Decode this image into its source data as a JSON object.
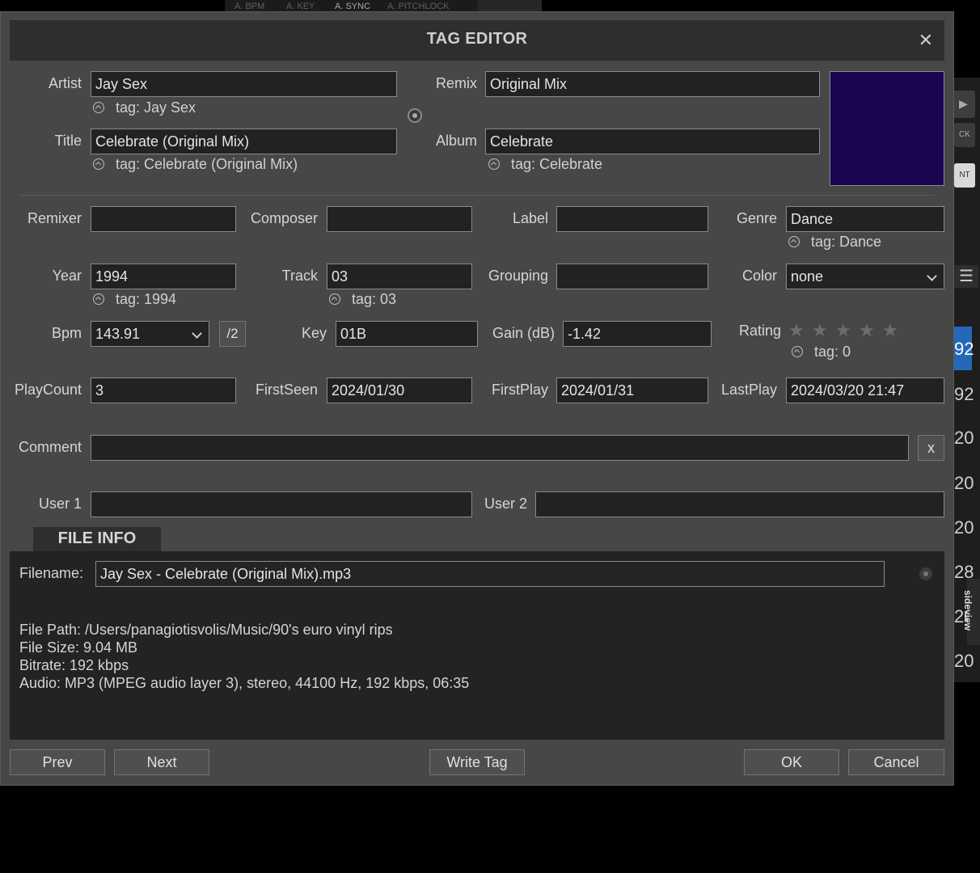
{
  "background": {
    "top_labels": [
      "A. BPM",
      "A. KEY",
      "A. SYNC",
      "A. PITCHLOCK"
    ],
    "right_values": [
      "92",
      "92",
      "20",
      "20",
      "20",
      "28",
      "20",
      "20"
    ],
    "right_buttons": [
      "CK",
      "NT"
    ],
    "sideview_label": "sideview"
  },
  "dialog": {
    "title": "TAG EDITOR",
    "close_glyph": "✕"
  },
  "labels": {
    "artist": "Artist",
    "remix": "Remix",
    "title": "Title",
    "album": "Album",
    "remixer": "Remixer",
    "composer": "Composer",
    "label": "Label",
    "genre": "Genre",
    "year": "Year",
    "track": "Track",
    "grouping": "Grouping",
    "color": "Color",
    "bpm": "Bpm",
    "key": "Key",
    "gain": "Gain (dB)",
    "rating": "Rating",
    "playcount": "PlayCount",
    "firstseen": "FirstSeen",
    "firstplay": "FirstPlay",
    "lastplay": "LastPlay",
    "comment": "Comment",
    "user1": "User 1",
    "user2": "User 2"
  },
  "values": {
    "artist": "Jay Sex",
    "remix": "Original Mix",
    "title": "Celebrate (Original Mix)",
    "album": "Celebrate",
    "remixer": "",
    "composer": "",
    "label": "",
    "genre": "Dance",
    "year": "1994",
    "track": "03",
    "grouping": "",
    "color": "none",
    "bpm": "143.91",
    "key": "01B",
    "gain": "-1.42",
    "rating": 0,
    "playcount": "3",
    "firstseen": "2024/01/30",
    "firstplay": "2024/01/31",
    "lastplay": "2024/03/20 21:47",
    "comment": "",
    "user1": "",
    "user2": ""
  },
  "tags": {
    "artist": "tag: Jay Sex",
    "title": "tag: Celebrate (Original Mix)",
    "album": "tag: Celebrate",
    "genre": "tag: Dance",
    "year": "tag: 1994",
    "track": "tag: 03",
    "rating": "tag: 0"
  },
  "buttons": {
    "half_bpm": "/2",
    "clear_comment": "x",
    "prev": "Prev",
    "next": "Next",
    "write_tag": "Write Tag",
    "ok": "OK",
    "cancel": "Cancel"
  },
  "artwork_color": "#1c0550",
  "file_info": {
    "tab_label": "FILE INFO",
    "filename_label": "Filename:",
    "filename": "Jay Sex - Celebrate (Original Mix).mp3",
    "path": "File Path: /Users/panagiotisvolis/Music/90's euro vinyl rips",
    "size": "File Size: 9.04 MB",
    "bitrate": "Bitrate: 192 kbps",
    "audio": "Audio: MP3 (MPEG audio layer 3), stereo, 44100 Hz, 192 kbps, 06:35"
  }
}
